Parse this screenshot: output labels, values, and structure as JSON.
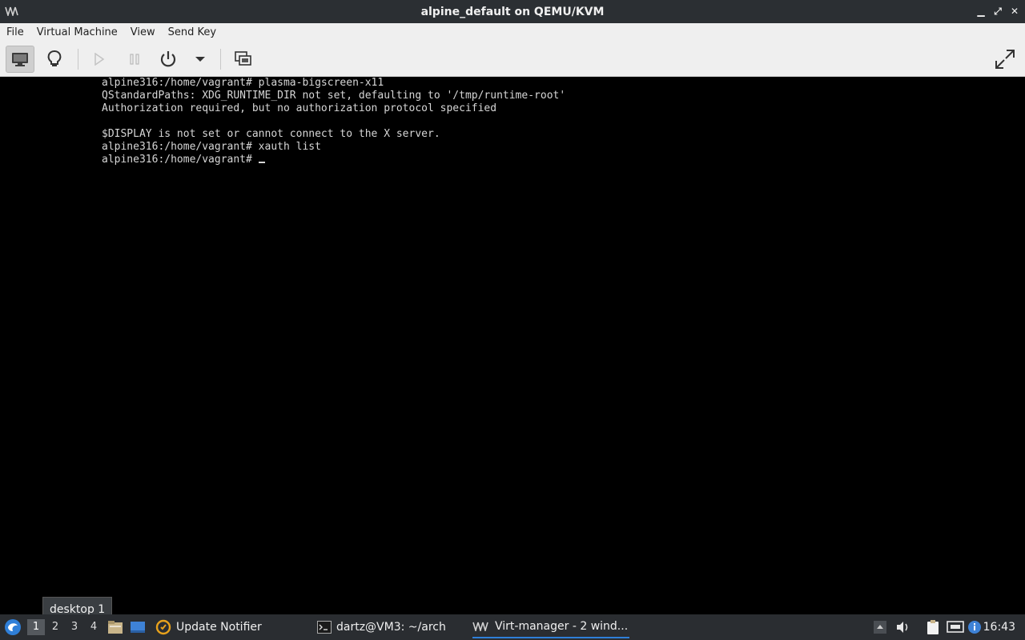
{
  "window": {
    "title": "alpine_default on QEMU/KVM",
    "controls": {
      "minimize": "▁",
      "maximize": "⤢",
      "close": "✕"
    }
  },
  "menubar": {
    "items": [
      {
        "label": "File"
      },
      {
        "label": "Virtual Machine"
      },
      {
        "label": "View"
      },
      {
        "label": "Send Key"
      }
    ]
  },
  "toolbar": {
    "buttons": [
      {
        "name": "graphical-console",
        "icon": "monitor-icon",
        "active": true
      },
      {
        "name": "vm-details",
        "icon": "lightbulb-icon",
        "active": false
      },
      {
        "name": "run",
        "icon": "play-icon",
        "disabled": true
      },
      {
        "name": "pause",
        "icon": "pause-icon",
        "disabled": true
      },
      {
        "name": "shutdown",
        "icon": "power-icon",
        "disabled": false
      },
      {
        "name": "shutdown-menu",
        "icon": "chevron-down-icon",
        "disabled": false
      },
      {
        "name": "snapshots",
        "icon": "snapshots-icon",
        "disabled": false
      },
      {
        "name": "fullscreen",
        "icon": "fullscreen-icon",
        "disabled": false
      }
    ]
  },
  "console": {
    "lines": [
      "alpine316:/home/vagrant# plasma-bigscreen-x11",
      "QStandardPaths: XDG_RUNTIME_DIR not set, defaulting to '/tmp/runtime-root'",
      "Authorization required, but no authorization protocol specified",
      "",
      "$DISPLAY is not set or cannot connect to the X server.",
      "alpine316:/home/vagrant# xauth list"
    ],
    "prompt": "alpine316:/home/vagrant# "
  },
  "tooltip": {
    "text": "desktop 1"
  },
  "taskbar": {
    "desktops": [
      "1",
      "2",
      "3",
      "4"
    ],
    "active_desktop": "1",
    "tasks": [
      {
        "label": "Update Notifier",
        "icon": "update-notifier-icon"
      },
      {
        "label": "dartz@VM3: ~/arch",
        "icon": "terminal-icon"
      },
      {
        "label": "Virt-manager - 2 wind...",
        "icon": "virt-manager-icon",
        "active": true
      }
    ],
    "clock": "16:43"
  },
  "colors": {
    "titlebar_bg": "#2b2f33",
    "menubar_bg": "#efefef",
    "console_bg": "#000000",
    "console_fg": "#d6d6d6",
    "taskbar_bg": "#2a2d31",
    "accent": "#2f7fd8"
  }
}
